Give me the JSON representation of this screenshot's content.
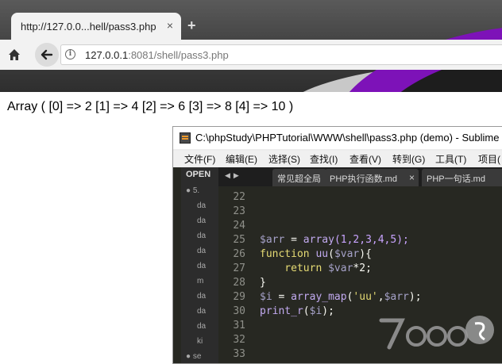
{
  "browser": {
    "tab_title": "http://127.0.0...hell/pass3.php",
    "tab_close": "×",
    "new_tab": "+",
    "url_host": "127.0.0.1",
    "url_rest": ":8081/shell/pass3.php"
  },
  "page": {
    "output": "Array ( [0] => 2 [1] => 4 [2] => 6 [3] => 8 [4] => 10 )"
  },
  "editor": {
    "title": "C:\\phpStudy\\PHPTutorial\\WWW\\shell\\pass3.php (demo) - Sublime",
    "menu": [
      "文件(F)",
      "编辑(E)",
      "选择(S)",
      "查找(I)",
      "查看(V)",
      "转到(G)",
      "工具(T)",
      "项目("
    ],
    "sidebar": {
      "header": "OPEN",
      "items": [
        "● 5.",
        "da",
        "da",
        "da",
        "da",
        "da",
        "m",
        "da",
        "da",
        "da",
        "ki",
        "● se"
      ]
    },
    "tabs": [
      {
        "label": "常见超全局"
      },
      {
        "label": "PHP执行函数.md",
        "close": "×"
      },
      {
        "label": "PHP一句话.md",
        "close": "×"
      }
    ],
    "line_numbers": [
      "22",
      "23",
      "24",
      "25",
      "26",
      "27",
      "28",
      "29",
      "30",
      "31",
      "32",
      "33"
    ],
    "code": {
      "l25": {
        "var": "$arr",
        "eq": " = ",
        "fn": "array",
        "args": "(1,2,3,4,5);"
      },
      "l26": {
        "kw": "function",
        "name": " uu",
        "open": "(",
        "param": "$var",
        "close": "){"
      },
      "l27": {
        "kw": "    return",
        "var": " $var",
        "rest": "*2;"
      },
      "l28": {
        "text": "}"
      },
      "l29": {
        "var": "$i",
        "eq": " = ",
        "fn": "array_map",
        "open": "(",
        "str": "'uu'",
        "comma": ",",
        "arg": "$arr",
        "close": ");"
      },
      "l30": {
        "fn": "print_r",
        "open": "(",
        "arg": "$i",
        "close": ");"
      }
    }
  },
  "colors": {
    "editor_bg": "#272822",
    "accent_purple": "#7d12b8"
  }
}
